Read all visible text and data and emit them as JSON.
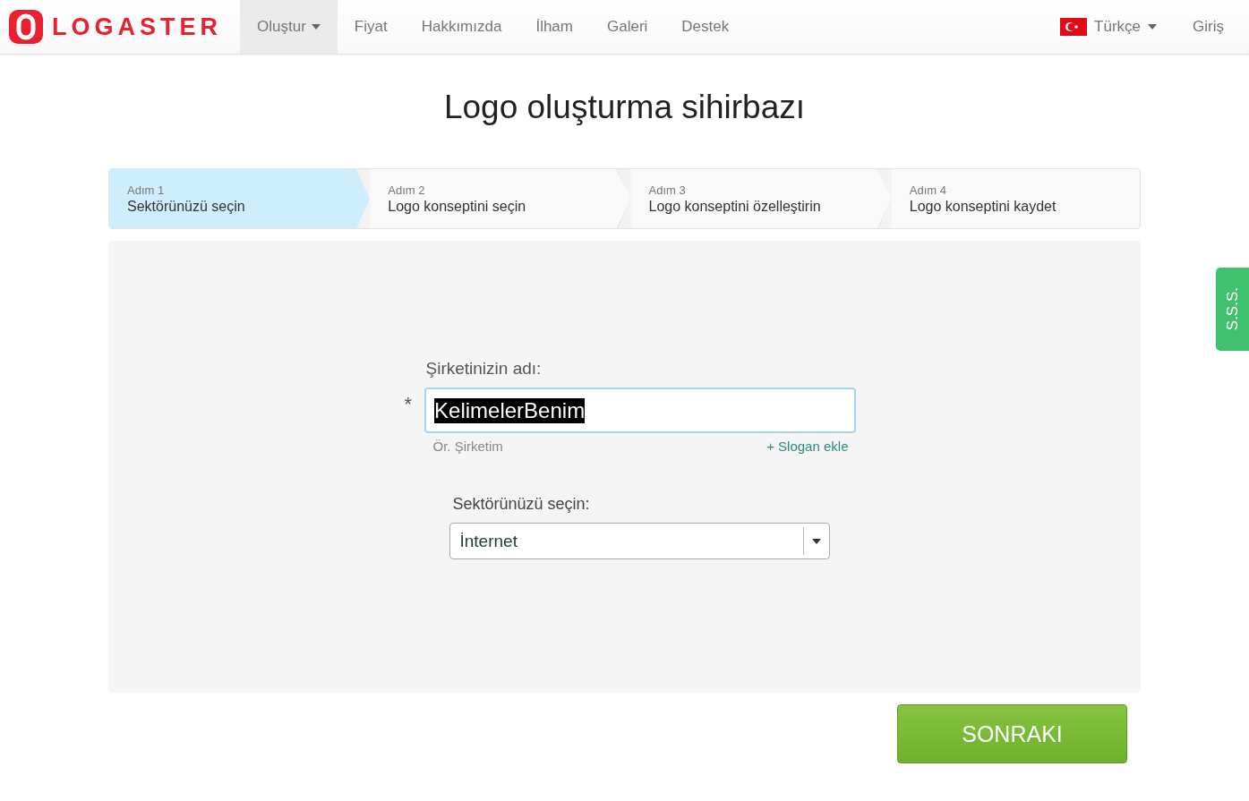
{
  "brand": {
    "name": "LOGASTER"
  },
  "nav": [
    {
      "label": "Oluştur",
      "selected": true,
      "dropdown": true
    },
    {
      "label": "Fiyat",
      "selected": false,
      "dropdown": false
    },
    {
      "label": "Hakkımızda",
      "selected": false,
      "dropdown": false
    },
    {
      "label": "İlham",
      "selected": false,
      "dropdown": false
    },
    {
      "label": "Galeri",
      "selected": false,
      "dropdown": false
    },
    {
      "label": "Destek",
      "selected": false,
      "dropdown": false
    }
  ],
  "language": {
    "label": "Türkçe"
  },
  "login": {
    "label": "Giriş"
  },
  "title": "Logo oluşturma sihirbazı",
  "steps": [
    {
      "step": "Adım 1",
      "label": "Sektörünüzü seçin",
      "selected": true
    },
    {
      "step": "Adım 2",
      "label": "Logo konseptini seçin",
      "selected": false
    },
    {
      "step": "Adım 3",
      "label": "Logo konseptini özelleştirin",
      "selected": false
    },
    {
      "step": "Adım 4",
      "label": "Logo konseptini kaydet",
      "selected": false
    }
  ],
  "form": {
    "company_label": "Şirketinizin adı:",
    "required_mark": "*",
    "company_value": "KelimelerBenim",
    "text_selected": true,
    "hint": "Ör. Şirketim",
    "slogan_link": "+ Slogan ekle",
    "sector_label": "Sektörünüzü seçin:",
    "sector_value": "İnternet"
  },
  "next_button": "SONRAKI",
  "faq_tab": "S.S.S."
}
